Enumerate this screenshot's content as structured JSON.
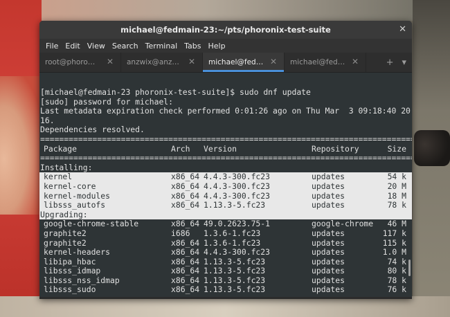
{
  "window": {
    "title": "michael@fedmain-23:~/pts/phoronix-test-suite",
    "close_glyph": "✕"
  },
  "menu": [
    "File",
    "Edit",
    "View",
    "Search",
    "Terminal",
    "Tabs",
    "Help"
  ],
  "tabs": [
    {
      "label": "root@phoro…",
      "active": false
    },
    {
      "label": "anzwix@anz…",
      "active": false
    },
    {
      "label": "michael@fed…",
      "active": true
    },
    {
      "label": "michael@fed…",
      "active": false
    }
  ],
  "tab_actions": {
    "new_tab": "+",
    "menu": "▾"
  },
  "terminal": {
    "lines": [
      "[michael@fedmain-23 phoronix-test-suite]$ sudo dnf update",
      "[sudo] password for michael:",
      "Last metadata expiration check performed 0:01:26 ago on Thu Mar  3 09:18:40 20",
      "16.",
      "Dependencies resolved."
    ],
    "separator": "================================================================================",
    "header": {
      "package": "Package",
      "arch": "Arch",
      "version": "Version",
      "repository": "Repository",
      "size": "Size"
    },
    "installing_label": "Installing:",
    "installing": [
      {
        "package": "kernel",
        "arch": "x86_64",
        "version": "4.4.3-300.fc23",
        "repository": "updates",
        "size": "54 k"
      },
      {
        "package": "kernel-core",
        "arch": "x86_64",
        "version": "4.4.3-300.fc23",
        "repository": "updates",
        "size": "20 M"
      },
      {
        "package": "kernel-modules",
        "arch": "x86_64",
        "version": "4.4.3-300.fc23",
        "repository": "updates",
        "size": "18 M"
      },
      {
        "package": "libsss_autofs",
        "arch": "x86_64",
        "version": "1.13.3-5.fc23",
        "repository": "updates",
        "size": "78 k"
      }
    ],
    "upgrading_label": "Upgrading:",
    "upgrading": [
      {
        "package": "google-chrome-stable",
        "arch": "x86_64",
        "version": "49.0.2623.75-1",
        "repository": "google-chrome",
        "size": "46 M"
      },
      {
        "package": "graphite2",
        "arch": "i686",
        "version": "1.3.6-1.fc23",
        "repository": "updates",
        "size": "117 k"
      },
      {
        "package": "graphite2",
        "arch": "x86_64",
        "version": "1.3.6-1.fc23",
        "repository": "updates",
        "size": "115 k"
      },
      {
        "package": "kernel-headers",
        "arch": "x86_64",
        "version": "4.4.3-300.fc23",
        "repository": "updates",
        "size": "1.0 M"
      },
      {
        "package": "libipa_hbac",
        "arch": "x86_64",
        "version": "1.13.3-5.fc23",
        "repository": "updates",
        "size": "74 k"
      },
      {
        "package": "libsss_idmap",
        "arch": "x86_64",
        "version": "1.13.3-5.fc23",
        "repository": "updates",
        "size": "80 k"
      },
      {
        "package": "libsss_nss_idmap",
        "arch": "x86_64",
        "version": "1.13.3-5.fc23",
        "repository": "updates",
        "size": "78 k"
      },
      {
        "package": "libsss_sudo",
        "arch": "x86_64",
        "version": "1.13.3-5.fc23",
        "repository": "updates",
        "size": "76 k"
      }
    ]
  }
}
